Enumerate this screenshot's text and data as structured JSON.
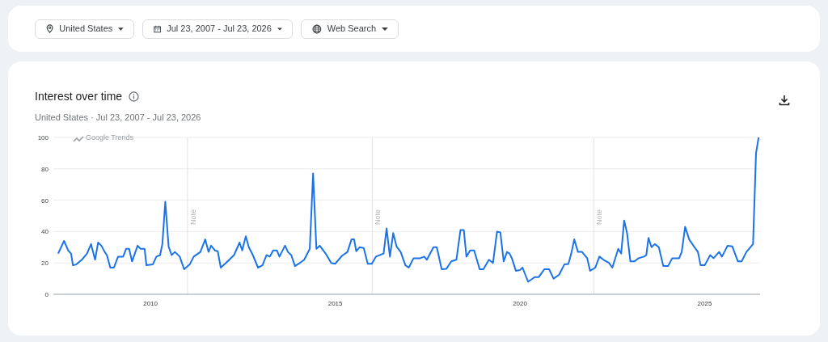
{
  "filters": [
    {
      "kind": "location",
      "label": "United States"
    },
    {
      "kind": "date",
      "label": "Jul 23, 2007 - Jul 23, 2026"
    },
    {
      "kind": "property",
      "label": "Web Search"
    }
  ],
  "interest_over_time": {
    "title": "Interest over time",
    "subtitle": "United States · Jul 23, 2007 - Jul 23, 2026",
    "brand_label": "Google Trends",
    "chart_data": {
      "type": "line",
      "grid": true,
      "xlim": [
        2007.37,
        2026.5
      ],
      "ylim": [
        0,
        100
      ],
      "xticks": [
        2010,
        2015,
        2020,
        2025
      ],
      "yticks": [
        0,
        20,
        40,
        60,
        80,
        100
      ],
      "annotations": [
        "Note",
        "Note",
        "Note"
      ],
      "x": [
        2007.5,
        2007.66,
        2007.77,
        2007.85,
        2007.9,
        2007.99,
        2008.14,
        2008.28,
        2008.39,
        2008.5,
        2008.58,
        2008.67,
        2008.76,
        2008.82,
        2008.91,
        2009.01,
        2009.12,
        2009.26,
        2009.34,
        2009.42,
        2009.5,
        2009.65,
        2009.73,
        2009.84,
        2009.89,
        2010.06,
        2010.16,
        2010.26,
        2010.32,
        2010.4,
        2010.49,
        2010.57,
        2010.66,
        2010.79,
        2010.91,
        2011.06,
        2011.17,
        2011.35,
        2011.48,
        2011.57,
        2011.64,
        2011.74,
        2011.82,
        2011.9,
        2012.04,
        2012.26,
        2012.41,
        2012.48,
        2012.58,
        2012.66,
        2012.77,
        2012.91,
        2013.03,
        2013.14,
        2013.23,
        2013.32,
        2013.42,
        2013.49,
        2013.64,
        2013.72,
        2013.81,
        2013.91,
        2014.01,
        2014.16,
        2014.31,
        2014.4,
        2014.49,
        2014.58,
        2014.74,
        2014.89,
        2015.0,
        2015.18,
        2015.33,
        2015.44,
        2015.51,
        2015.57,
        2015.66,
        2015.77,
        2015.88,
        2015.99,
        2016.1,
        2016.31,
        2016.39,
        2016.48,
        2016.57,
        2016.66,
        2016.77,
        2016.9,
        2016.99,
        2017.12,
        2017.3,
        2017.41,
        2017.48,
        2017.66,
        2017.75,
        2017.88,
        2018.01,
        2018.14,
        2018.28,
        2018.39,
        2018.48,
        2018.55,
        2018.65,
        2018.76,
        2018.91,
        2019.01,
        2019.16,
        2019.27,
        2019.38,
        2019.47,
        2019.56,
        2019.65,
        2019.72,
        2019.78,
        2019.89,
        2020.0,
        2020.07,
        2020.22,
        2020.4,
        2020.51,
        2020.66,
        2020.79,
        2020.91,
        2021.06,
        2021.2,
        2021.31,
        2021.39,
        2021.47,
        2021.57,
        2021.68,
        2021.82,
        2021.9,
        2022.04,
        2022.15,
        2022.26,
        2022.41,
        2022.5,
        2022.66,
        2022.74,
        2022.82,
        2022.9,
        2022.99,
        2023.1,
        2023.21,
        2023.36,
        2023.42,
        2023.48,
        2023.56,
        2023.65,
        2023.76,
        2023.88,
        2024.01,
        2024.12,
        2024.31,
        2024.38,
        2024.47,
        2024.58,
        2024.71,
        2024.82,
        2024.89,
        2025.0,
        2025.15,
        2025.24,
        2025.39,
        2025.47,
        2025.62,
        2025.75,
        2025.9,
        2026.0,
        2026.13,
        2026.31,
        2026.39,
        2026.46
      ],
      "series": [
        {
          "color": "#1a73e8",
          "values": [
            26,
            34,
            28,
            26,
            18.5,
            19,
            22,
            26,
            32,
            22,
            33,
            31,
            27,
            25,
            17,
            17,
            24,
            24,
            29,
            29,
            21,
            31,
            29,
            29,
            18.5,
            19,
            24,
            25,
            32,
            59,
            30.5,
            25,
            27,
            24,
            16,
            19,
            24,
            27,
            35,
            27,
            31,
            28,
            27.5,
            17,
            20,
            25,
            33,
            28,
            37,
            30,
            25,
            17,
            18.5,
            25,
            24,
            28,
            28,
            24,
            31,
            27,
            25,
            18,
            19.5,
            22,
            29,
            77,
            29,
            31,
            26,
            20,
            19.5,
            24.5,
            27,
            35,
            35,
            27.5,
            30,
            29.5,
            19.5,
            19.5,
            24,
            26,
            42,
            24,
            39,
            30.5,
            27,
            18.5,
            17,
            23,
            23,
            24,
            22,
            30,
            30,
            16,
            16.3,
            21,
            22,
            41,
            41,
            24,
            28,
            28,
            16,
            16,
            22,
            20,
            40,
            39.5,
            21,
            27,
            26,
            23,
            15,
            15.4,
            17,
            8,
            11,
            11,
            16,
            16,
            10,
            12.5,
            19,
            19.4,
            26,
            35,
            27,
            27,
            23,
            15,
            17,
            24,
            22,
            20,
            17,
            29,
            26,
            47,
            39,
            21,
            21,
            23,
            24,
            25,
            36,
            30,
            32,
            30,
            18,
            18,
            23,
            23,
            27,
            43,
            35,
            30.5,
            27,
            18.5,
            18.5,
            25,
            23,
            27,
            24,
            31,
            30.5,
            21,
            21,
            27,
            32,
            90,
            100
          ]
        }
      ]
    }
  }
}
